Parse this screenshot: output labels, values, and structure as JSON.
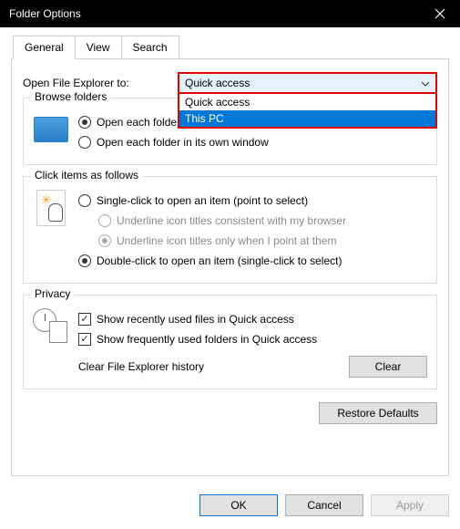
{
  "window": {
    "title": "Folder Options"
  },
  "tabs": {
    "general": "General",
    "view": "View",
    "search": "Search"
  },
  "open_to": {
    "label": "Open File Explorer to:",
    "selected": "Quick access",
    "options": {
      "quick": "Quick access",
      "thispc": "This PC"
    }
  },
  "browse": {
    "legend": "Browse folders",
    "same": "Open each folder in the same window",
    "own": "Open each folder in its own window"
  },
  "click": {
    "legend": "Click items as follows",
    "single": "Single-click to open an item (point to select)",
    "uline_browser": "Underline icon titles consistent with my browser",
    "uline_point": "Underline icon titles only when I point at them",
    "double": "Double-click to open an item (single-click to select)"
  },
  "privacy": {
    "legend": "Privacy",
    "recent_files": "Show recently used files in Quick access",
    "freq_folders": "Show frequently used folders in Quick access",
    "clear_label": "Clear File Explorer history",
    "clear_btn": "Clear"
  },
  "restore": "Restore Defaults",
  "footer": {
    "ok": "OK",
    "cancel": "Cancel",
    "apply": "Apply"
  }
}
